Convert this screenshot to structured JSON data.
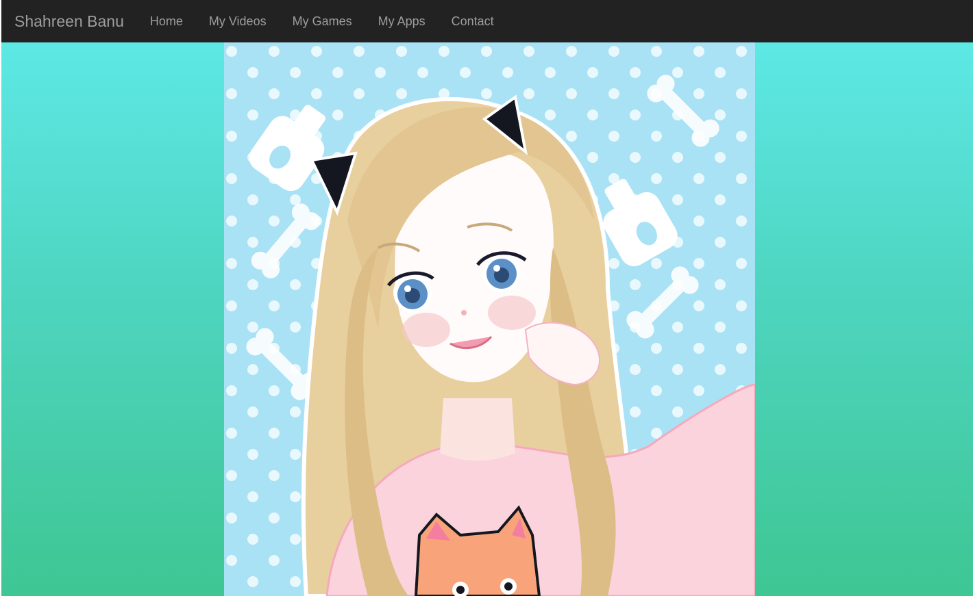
{
  "navbar": {
    "brand": "Shahreen Banu",
    "items": [
      {
        "label": "Home"
      },
      {
        "label": "My Videos"
      },
      {
        "label": "My Games"
      },
      {
        "label": "My Apps"
      },
      {
        "label": "Contact"
      }
    ]
  },
  "hero": {
    "image_icon": "anime-girl-illustration",
    "colors": {
      "navbar_bg": "#222222",
      "nav_text": "#9d9d9d",
      "gradient_top": "#5de8e5",
      "gradient_bottom": "#3ec693",
      "art_bg": "#a9e2f5"
    }
  }
}
